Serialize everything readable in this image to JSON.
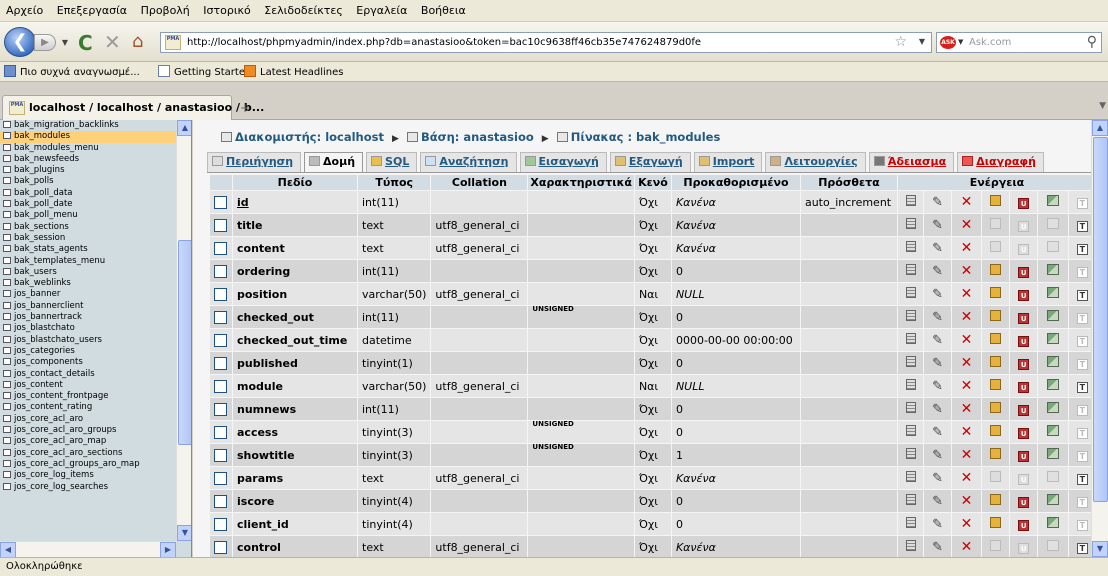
{
  "menu": [
    "Αρχείο",
    "Επεξεργασία",
    "Προβολή",
    "Ιστορικό",
    "Σελιδοδείκτες",
    "Εργαλεία",
    "Βοήθεια"
  ],
  "url": "http://localhost/phpmyadmin/index.php?db=anastasioo&token=bac10c9638ff46cb35e747624879d0fe",
  "search_placeholder": "Ask.com",
  "bookmarks": [
    "Πιο συχνά αναγνωσμέ...",
    "Getting Started",
    "Latest Headlines"
  ],
  "tab_title": "localhost / localhost / anastasioo / b...",
  "tab_new": "+",
  "tables": [
    "bak_migration_backlinks",
    "bak_modules",
    "bak_modules_menu",
    "bak_newsfeeds",
    "bak_plugins",
    "bak_polls",
    "bak_poll_data",
    "bak_poll_date",
    "bak_poll_menu",
    "bak_sections",
    "bak_session",
    "bak_stats_agents",
    "bak_templates_menu",
    "bak_users",
    "bak_weblinks",
    "jos_banner",
    "jos_bannerclient",
    "jos_bannertrack",
    "jos_blastchato",
    "jos_blastchato_users",
    "jos_categories",
    "jos_components",
    "jos_contact_details",
    "jos_content",
    "jos_content_frontpage",
    "jos_content_rating",
    "jos_core_acl_aro",
    "jos_core_acl_aro_groups",
    "jos_core_acl_aro_map",
    "jos_core_acl_aro_sections",
    "jos_core_acl_groups_aro_map",
    "jos_core_log_items",
    "jos_core_log_searches"
  ],
  "breadcrumb": {
    "server_label": "Διακομιστής: localhost",
    "db_label": "Βάση: anastasioo",
    "table_label": "Πίνακας : bak_modules"
  },
  "page_tabs": [
    "Περιήγηση",
    "Δομή",
    "SQL",
    "Αναζήτηση",
    "Εισαγωγή",
    "Εξαγωγή",
    "Import",
    "Λειτουργίες",
    "Άδειασμα",
    "Διαγραφή"
  ],
  "columns": [
    "Πεδίο",
    "Τύπος",
    "Collation",
    "Χαρακτηριστικά",
    "Κενό",
    "Προκαθορισμένο",
    "Πρόσθετα",
    "Ενέργεια"
  ],
  "rows": [
    {
      "field": "id",
      "type": "int(11)",
      "collation": "",
      "attributes": "",
      "null": "Όχι",
      "default": "Κανένα",
      "extra": "auto_increment"
    },
    {
      "field": "title",
      "type": "text",
      "collation": "utf8_general_ci",
      "attributes": "",
      "null": "Όχι",
      "default": "Κανένα",
      "extra": ""
    },
    {
      "field": "content",
      "type": "text",
      "collation": "utf8_general_ci",
      "attributes": "",
      "null": "Όχι",
      "default": "Κανένα",
      "extra": ""
    },
    {
      "field": "ordering",
      "type": "int(11)",
      "collation": "",
      "attributes": "",
      "null": "Όχι",
      "default": "0",
      "extra": ""
    },
    {
      "field": "position",
      "type": "varchar(50)",
      "collation": "utf8_general_ci",
      "attributes": "",
      "null": "Ναι",
      "default": "NULL",
      "extra": ""
    },
    {
      "field": "checked_out",
      "type": "int(11)",
      "collation": "",
      "attributes": "UNSIGNED",
      "null": "Όχι",
      "default": "0",
      "extra": ""
    },
    {
      "field": "checked_out_time",
      "type": "datetime",
      "collation": "",
      "attributes": "",
      "null": "Όχι",
      "default": "0000-00-00 00:00:00",
      "extra": ""
    },
    {
      "field": "published",
      "type": "tinyint(1)",
      "collation": "",
      "attributes": "",
      "null": "Όχι",
      "default": "0",
      "extra": ""
    },
    {
      "field": "module",
      "type": "varchar(50)",
      "collation": "utf8_general_ci",
      "attributes": "",
      "null": "Ναι",
      "default": "NULL",
      "extra": ""
    },
    {
      "field": "numnews",
      "type": "int(11)",
      "collation": "",
      "attributes": "",
      "null": "Όχι",
      "default": "0",
      "extra": ""
    },
    {
      "field": "access",
      "type": "tinyint(3)",
      "collation": "",
      "attributes": "UNSIGNED",
      "null": "Όχι",
      "default": "0",
      "extra": ""
    },
    {
      "field": "showtitle",
      "type": "tinyint(3)",
      "collation": "",
      "attributes": "UNSIGNED",
      "null": "Όχι",
      "default": "1",
      "extra": ""
    },
    {
      "field": "params",
      "type": "text",
      "collation": "utf8_general_ci",
      "attributes": "",
      "null": "Όχι",
      "default": "Κανένα",
      "extra": ""
    },
    {
      "field": "iscore",
      "type": "tinyint(4)",
      "collation": "",
      "attributes": "",
      "null": "Όχι",
      "default": "0",
      "extra": ""
    },
    {
      "field": "client_id",
      "type": "tinyint(4)",
      "collation": "",
      "attributes": "",
      "null": "Όχι",
      "default": "0",
      "extra": ""
    },
    {
      "field": "control",
      "type": "text",
      "collation": "utf8_general_ci",
      "attributes": "",
      "null": "Όχι",
      "default": "Κανένα",
      "extra": ""
    }
  ],
  "status": "Ολοκληρώθηκε"
}
